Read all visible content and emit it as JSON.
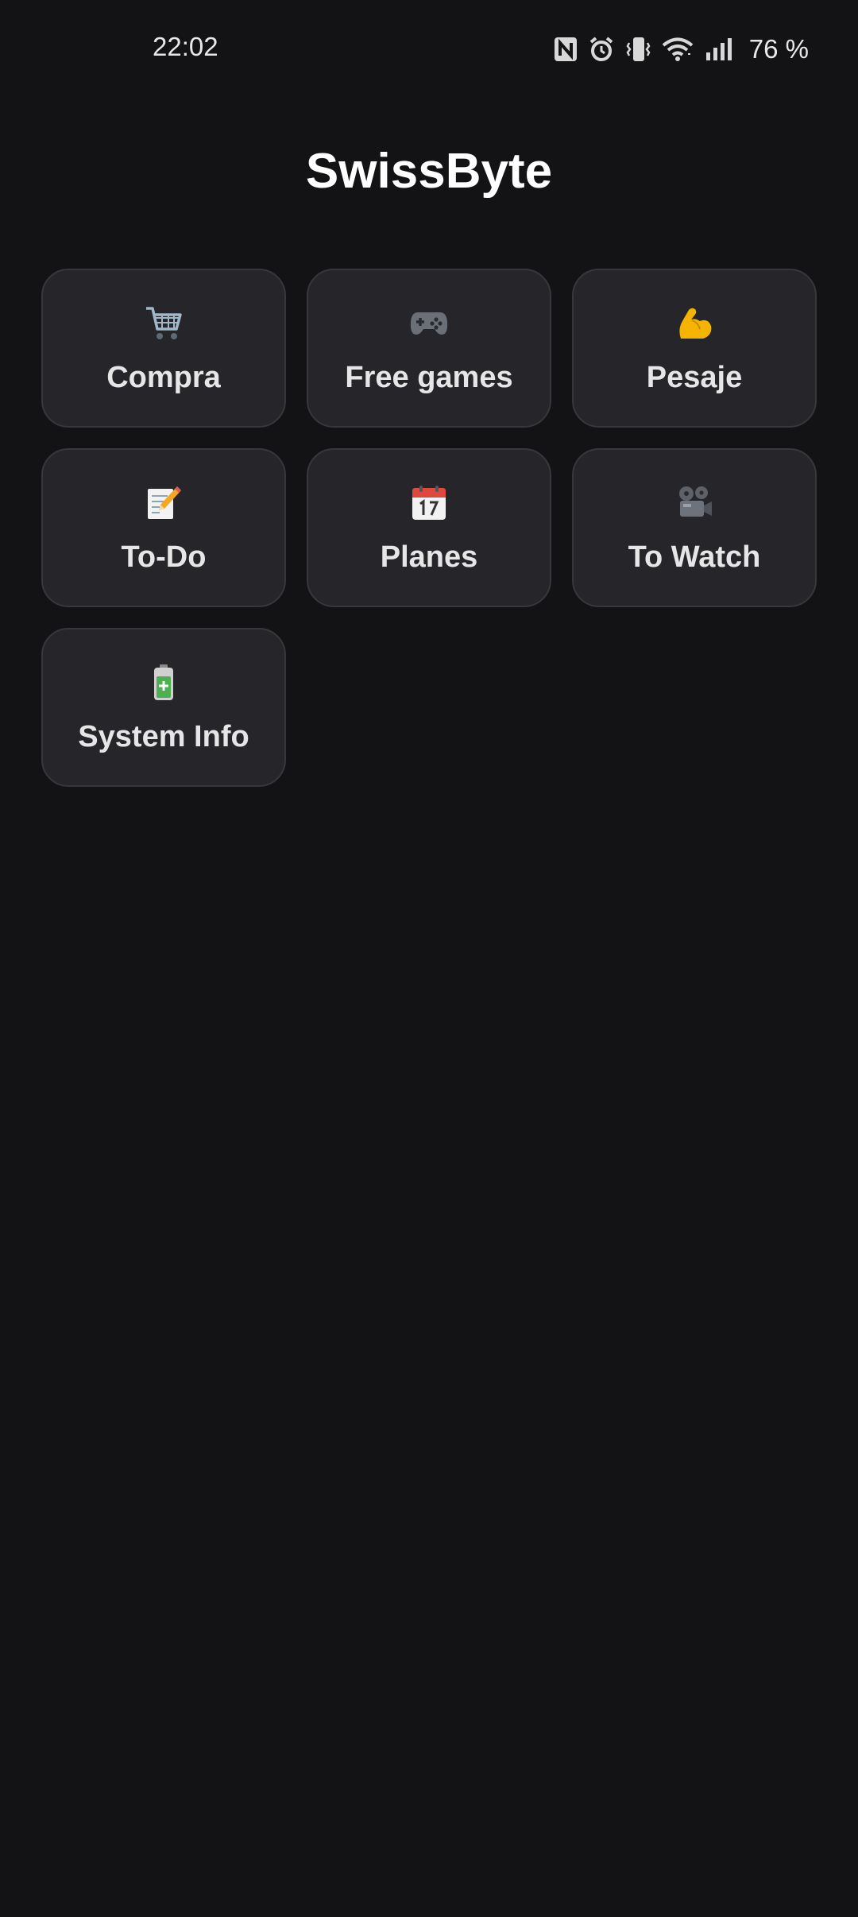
{
  "status_bar": {
    "time": "22:02",
    "battery_percent": "76 %",
    "icons": [
      "nfc-icon",
      "alarm-icon",
      "vibrate-icon",
      "wifi-icon",
      "signal-icon"
    ]
  },
  "app": {
    "title": "SwissByte"
  },
  "tiles": [
    {
      "label": "Compra",
      "icon": "shopping-cart-icon"
    },
    {
      "label": "Free games",
      "icon": "game-controller-icon"
    },
    {
      "label": "Pesaje",
      "icon": "flexed-biceps-icon"
    },
    {
      "label": "To-Do",
      "icon": "memo-icon"
    },
    {
      "label": "Planes",
      "icon": "calendar-icon"
    },
    {
      "label": "To Watch",
      "icon": "film-projector-icon"
    },
    {
      "label": "System Info",
      "icon": "battery-icon"
    }
  ],
  "colors": {
    "background": "#131315",
    "tile_background": "#26262a",
    "tile_border": "#37373c",
    "text": "#e6e6e6"
  }
}
